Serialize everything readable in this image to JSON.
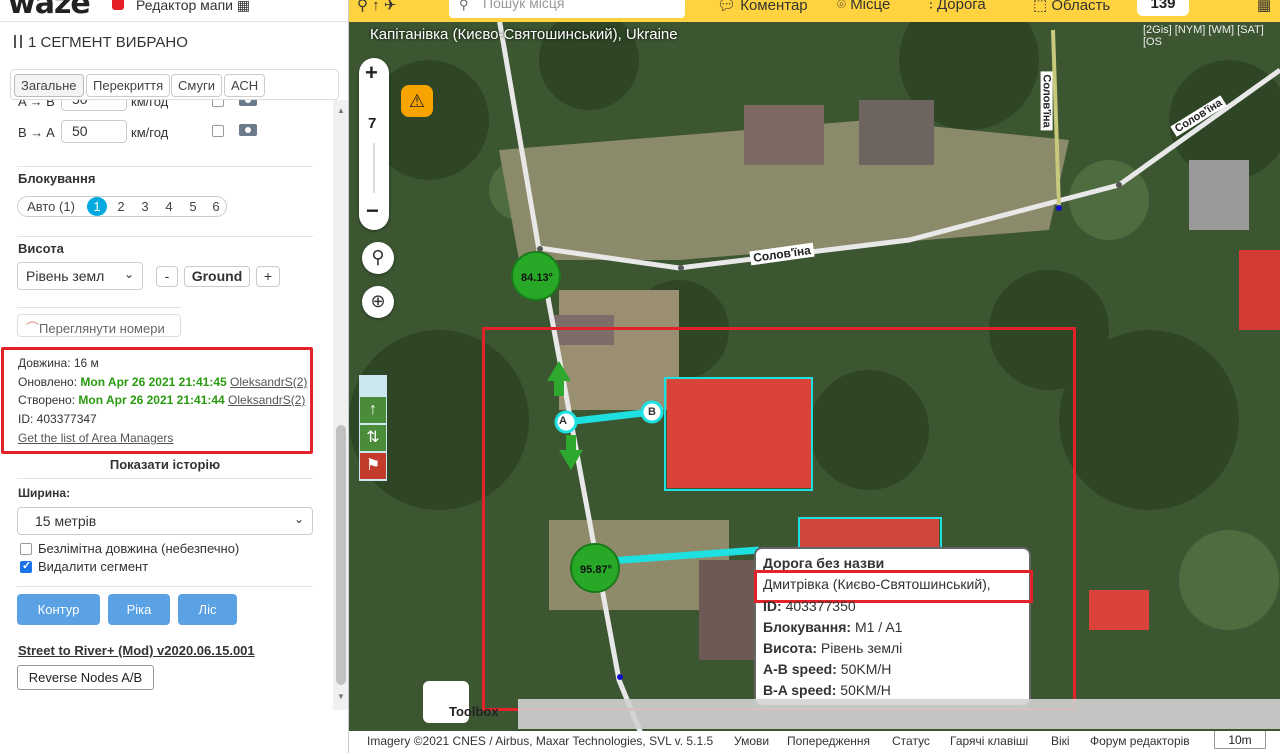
{
  "header": {
    "logo_text": "waze",
    "editor_title": "Редактор мапи ▦",
    "selection_title": "1 СЕГМЕНТ ВИБРАНО"
  },
  "tabs": [
    {
      "label": "Загальне",
      "active": true
    },
    {
      "label": "Перекриття",
      "active": false
    },
    {
      "label": "Смуги",
      "active": false
    },
    {
      "label": "АСН",
      "active": false
    }
  ],
  "speed": {
    "ab_label": "A → B",
    "ab_value": "50",
    "ba_label": "B → A",
    "ba_value": "50",
    "unit": "км/год"
  },
  "lock": {
    "title": "Блокування",
    "auto_label": "Авто (1)",
    "levels": [
      "1",
      "2",
      "3",
      "4",
      "5",
      "6"
    ],
    "selected": "1"
  },
  "elevation": {
    "title": "Висота",
    "selected": "Рівень земл",
    "minus": "-",
    "value": "Ground",
    "plus": "+"
  },
  "house_numbers_button": "Переглянути номери",
  "info": {
    "length": "Довжина: 16 м",
    "updated_label": "Оновлено:",
    "updated_date": "Mon Apr 26 2021 21:41:45",
    "updated_user": "OleksandrS(2)",
    "created_label": "Створено:",
    "created_date": "Mon Apr 26 2021 21:41:44",
    "created_user": "OleksandrS(2)",
    "id": "ID: 403377347",
    "area_managers_link": "Get the list of Area Managers"
  },
  "history_link": "Показати історію",
  "width": {
    "title": "Ширина:",
    "selected": "15 метрів"
  },
  "checkboxes": {
    "unlimited_label": "Безлімітна довжина (небезпечно)",
    "unlimited_checked": false,
    "delete_label": "Видалити сегмент",
    "delete_checked": true
  },
  "buttons": {
    "contour": "Контур",
    "river": "Ріка",
    "forest": "Ліс"
  },
  "script": {
    "title": "Street to River+ (Mod) v2020.06.15.001",
    "reverse_button": "Reverse Nodes A/B"
  },
  "topbar": {
    "search_placeholder": "Пошук місця",
    "comment": "Коментар",
    "place": "Місце",
    "road": "Дорога",
    "area": "Область",
    "count": "139"
  },
  "map": {
    "location_title": "Капітанівка (Києво-Святошинський), Ukraine",
    "layer_links": "[2Gis] [NYM] [WM] [SAT] [OS",
    "zoom_level": "7",
    "street_label_1": "Солов'їна",
    "street_label_2": "Солов'їна",
    "street_label_3": "Солов'їна",
    "node_a": "A",
    "node_b": "B",
    "angle_1": "84.13°",
    "angle_2": "95.87°",
    "toolbox": "Toolbox"
  },
  "popup": {
    "title": "Дорога без назви",
    "city": "Дмитрівка (Києво-Святошинський),",
    "id_label": "ID:",
    "id_value": "403377350",
    "lock_label": "Блокування:",
    "lock_value": "M1 / A1",
    "elev_label": "Висота:",
    "elev_value": "Рівень землі",
    "ab_label": "A-B speed:",
    "ab_value": "50KM/H",
    "ba_label": "B-A speed:",
    "ba_value": "50KM/H"
  },
  "bottom": {
    "imagery": "Imagery ©2021 CNES / Airbus, Maxar Technologies, SVL v. 5.1.5",
    "terms": "Умови",
    "warnings": "Попередження",
    "status": "Статус",
    "hotkeys": "Гарячі клавіші",
    "wiki": "Вікі",
    "forum": "Форум редакторів",
    "scale": "10m"
  },
  "colors": {
    "accent_blue": "#00a9e0",
    "waze_yellow": "#ffd23f",
    "highlight_red": "#e2232a",
    "segment_cyan": "#1ee0e0",
    "green_date": "#2a9a10"
  }
}
